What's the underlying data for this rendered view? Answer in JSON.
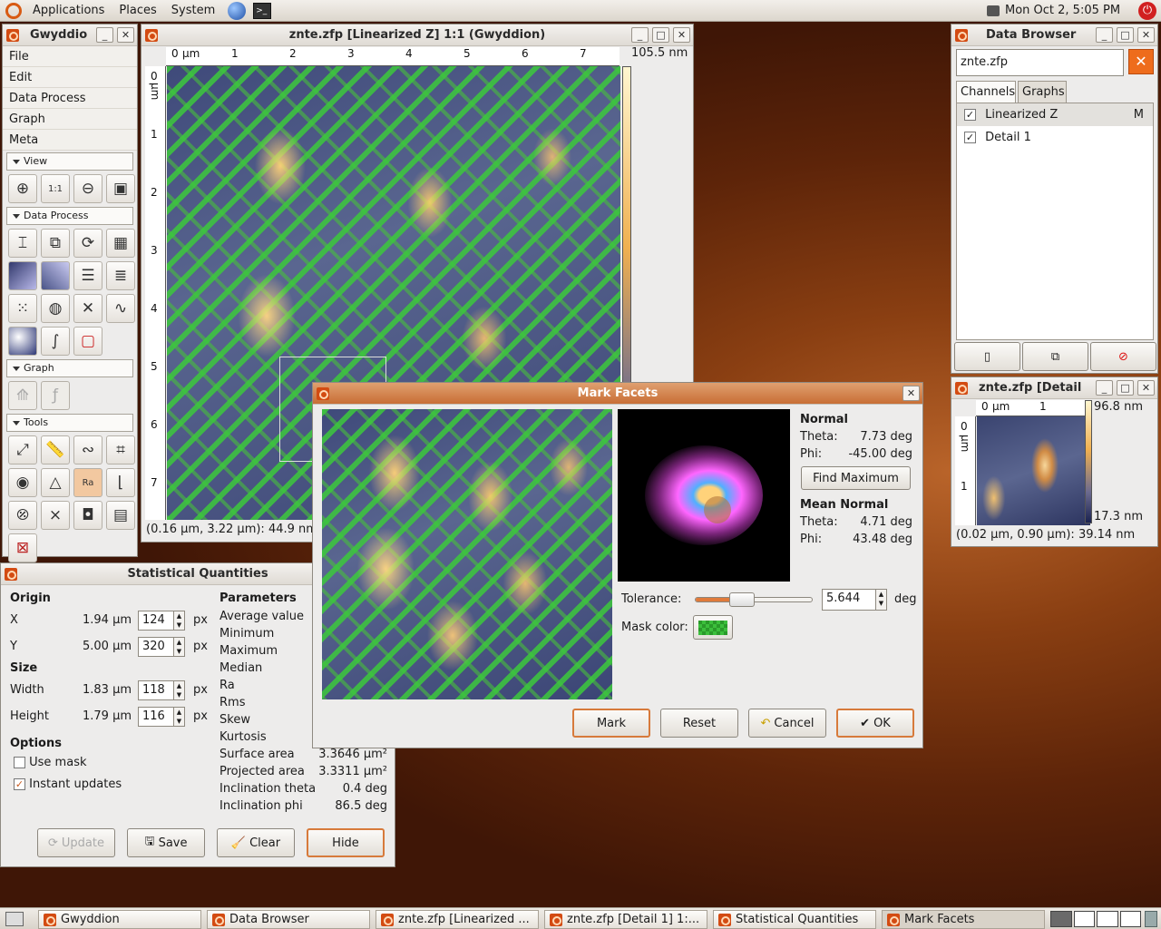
{
  "topbar": {
    "applications": "Applications",
    "places": "Places",
    "system": "System",
    "clock": "Mon Oct  2,  5:05 PM"
  },
  "toolbox": {
    "title": "Gwyddio",
    "menu": [
      "File",
      "Edit",
      "Data Process",
      "Graph",
      "Meta"
    ],
    "sections": {
      "view": "View",
      "data_process": "Data Process",
      "graph": "Graph",
      "tools": "Tools"
    }
  },
  "data_window": {
    "title": "znte.zfp [Linearized Z] 1:1 (Gwyddion)",
    "x_ticks": [
      "0",
      "1",
      "2",
      "3",
      "4",
      "5",
      "6",
      "7"
    ],
    "unit": "µm",
    "y_ticks": [
      "0",
      "1",
      "2",
      "3",
      "4",
      "5",
      "6",
      "7"
    ],
    "scale_max": "105.5 nm",
    "status": "(0.16 µm, 3.22 µm): 44.9 nm"
  },
  "browser": {
    "title": "Data Browser",
    "filename": "znte.zfp",
    "tabs": [
      "Channels",
      "Graphs"
    ],
    "channels": [
      {
        "name": "Linearized Z",
        "flag": "M"
      },
      {
        "name": "Detail 1",
        "flag": ""
      }
    ]
  },
  "detail": {
    "title": "znte.zfp [Detail",
    "x_ticks": [
      "0",
      "1"
    ],
    "unit": "µm",
    "y_ticks": [
      "0",
      "1"
    ],
    "scale_max": "96.8 nm",
    "scale_min": "17.3 nm",
    "status": "(0.02 µm, 0.90 µm): 39.14 nm"
  },
  "stats": {
    "title": "Statistical Quantities",
    "origin": "Origin",
    "x_label": "X",
    "x_value": "1.94 µm",
    "x_px": "124",
    "y_label": "Y",
    "y_value": "5.00 µm",
    "y_px": "320",
    "size": "Size",
    "w_label": "Width",
    "w_value": "1.83 µm",
    "w_px": "118",
    "h_label": "Height",
    "h_value": "1.79 µm",
    "h_px": "116",
    "px": "px",
    "options": "Options",
    "use_mask": "Use mask",
    "instant": "Instant updates",
    "parameters": "Parameters",
    "params": [
      "Average value",
      "Minimum",
      "Maximum",
      "Median",
      "Ra",
      "Rms",
      "Skew",
      "Kurtosis",
      "Surface area",
      "Projected area",
      "Inclination theta",
      "Inclination phi"
    ],
    "surface_area": "3.3646 µm²",
    "projected_area": "3.3311 µm²",
    "incl_theta": "0.4 deg",
    "incl_phi": "86.5 deg",
    "buttons": {
      "update": "Update",
      "save": "Save",
      "clear": "Clear",
      "hide": "Hide"
    }
  },
  "facets": {
    "title": "Mark Facets",
    "normal": "Normal",
    "theta_label": "Theta:",
    "theta": "7.73 deg",
    "phi_label": "Phi:",
    "phi": "-45.00 deg",
    "find_max": "Find Maximum",
    "mean_normal": "Mean Normal",
    "m_theta": "4.71 deg",
    "m_phi": "43.48 deg",
    "tolerance_label": "Tolerance:",
    "tolerance": "5.644",
    "tolerance_unit": "deg",
    "tolerance_fraction": 0.4,
    "mask_color_label": "Mask color:",
    "buttons": {
      "mark": "Mark",
      "reset": "Reset",
      "cancel": "Cancel",
      "ok": "OK"
    }
  },
  "taskbar": [
    "Gwyddion",
    "Data Browser",
    "znte.zfp [Linearized ...",
    "znte.zfp [Detail 1] 1:...",
    "Statistical Quantities",
    "Mark Facets"
  ]
}
